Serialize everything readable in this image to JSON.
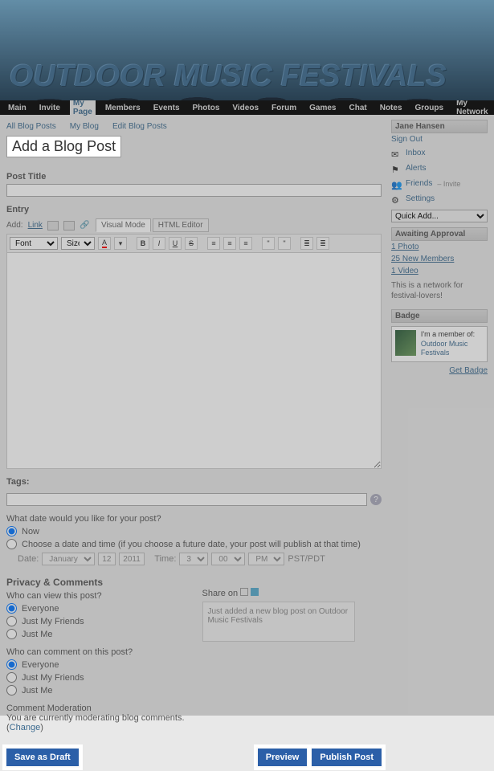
{
  "site": {
    "title": "OUTDOOR MUSIC FESTIVALS"
  },
  "nav": {
    "items": [
      "Main",
      "Invite",
      "My Page",
      "Members",
      "Events",
      "Photos",
      "Videos",
      "Forum",
      "Games",
      "Chat",
      "Notes",
      "Groups",
      "My Network"
    ],
    "active": "My Page"
  },
  "sub_nav": {
    "all": "All Blog Posts",
    "my": "My Blog",
    "edit": "Edit Blog Posts"
  },
  "page": {
    "title": "Add a Blog Post"
  },
  "form": {
    "post_title_label": "Post Title",
    "entry_label": "Entry",
    "add_label": "Add:",
    "add_link": "Link",
    "visual_mode": "Visual Mode",
    "html_editor": "HTML Editor",
    "font_label": "Font",
    "size_label": "Size",
    "tags_label": "Tags:",
    "date_question": "What date would you like for your post?",
    "now_label": "Now",
    "choose_label": "Choose a date and time (if you choose a future date, your post will publish at that time)",
    "date_word": "Date:",
    "month": "January",
    "day": "12",
    "year": "2011",
    "time_word": "Time:",
    "hour": "3",
    "minute": "00",
    "ampm": "PM",
    "tz": "PST/PDT"
  },
  "privacy": {
    "header": "Privacy & Comments",
    "view_q": "Who can view this post?",
    "comment_q": "Who can comment on this post?",
    "opt_everyone": "Everyone",
    "opt_friends": "Just My Friends",
    "opt_me": "Just Me",
    "share_label": "Share on",
    "share_text": "Just added a new blog post on Outdoor Music Festivals",
    "mod_header": "Comment Moderation",
    "mod_text": "You are currently moderating blog comments. (",
    "mod_change": "Change",
    "mod_close": ")"
  },
  "actions": {
    "draft": "Save as Draft",
    "preview": "Preview",
    "publish": "Publish Post"
  },
  "sidebar": {
    "user": "Jane Hansen",
    "signout": "Sign Out",
    "inbox": "Inbox",
    "alerts": "Alerts",
    "friends": "Friends",
    "friends_invite": "– Invite",
    "settings": "Settings",
    "quick_add": "Quick Add...",
    "approval_header": "Awaiting Approval",
    "approval_photo": "1 Photo",
    "approval_members": "25 New Members",
    "approval_video": "1 Video",
    "network_text": "This is a network for festival-lovers!",
    "badge_header": "Badge",
    "badge_member": "I'm a member of:",
    "badge_name": "Outdoor Music Festivals",
    "get_badge": "Get Badge"
  }
}
